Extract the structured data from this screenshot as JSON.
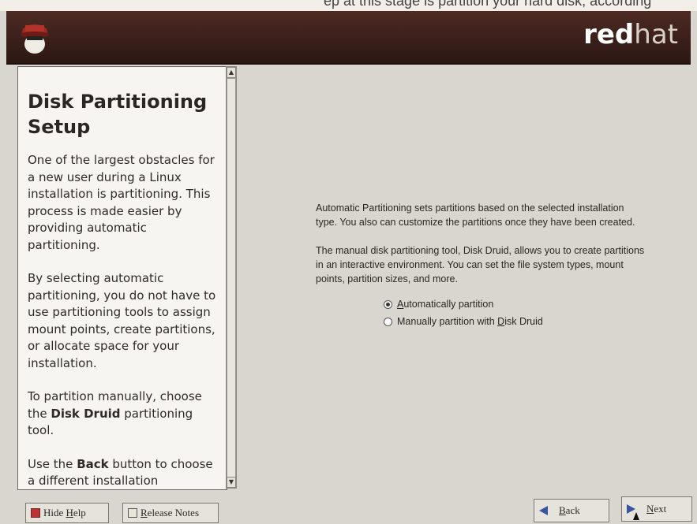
{
  "top_strip": {
    "text": "ep at this stage is partition your hard disk, according"
  },
  "header": {
    "brand_bold": "red",
    "brand_light": "hat"
  },
  "help": {
    "title": "Disk Partitioning Setup",
    "paragraphs": [
      "One of the largest obstacles for a new user during a Linux installation is partitioning. This process is made easier by providing automatic partitioning.",
      "By selecting automatic partitioning, you do not have to use partitioning tools to assign mount points, create partitions, or allocate space for your installation."
    ],
    "p3_pre": "To partition manually, choose the ",
    "p3_bold": "Disk Druid",
    "p3_post": " partitioning tool.",
    "p4_pre": "Use the ",
    "p4_bold": "Back",
    "p4_post": " button to choose a different installation"
  },
  "main": {
    "para1": "Automatic Partitioning sets partitions based on the selected installation type. You also can customize the partitions once they have been created.",
    "para2": "The manual disk partitioning tool, Disk Druid, allows you to create partitions in an interactive environment. You can set the file system types, mount points, partition sizes, and more.",
    "options": [
      {
        "accel": "A",
        "rest": "utomatically partition",
        "selected": true
      },
      {
        "pre": "Manually partition with ",
        "accel": "D",
        "rest": "isk Druid",
        "selected": false
      }
    ]
  },
  "buttons": {
    "hide_help_pre": "Hide ",
    "hide_help_accel": "H",
    "hide_help_rest": "elp",
    "release_accel": "R",
    "release_rest": "elease Notes",
    "back_accel": "B",
    "back_rest": "ack",
    "next_accel": "N",
    "next_rest": "ext"
  },
  "icons": [
    "shadowman-logo-icon",
    "help-icon",
    "release-notes-icon",
    "back-arrow-icon",
    "next-arrow-icon",
    "mouse-cursor-icon"
  ]
}
